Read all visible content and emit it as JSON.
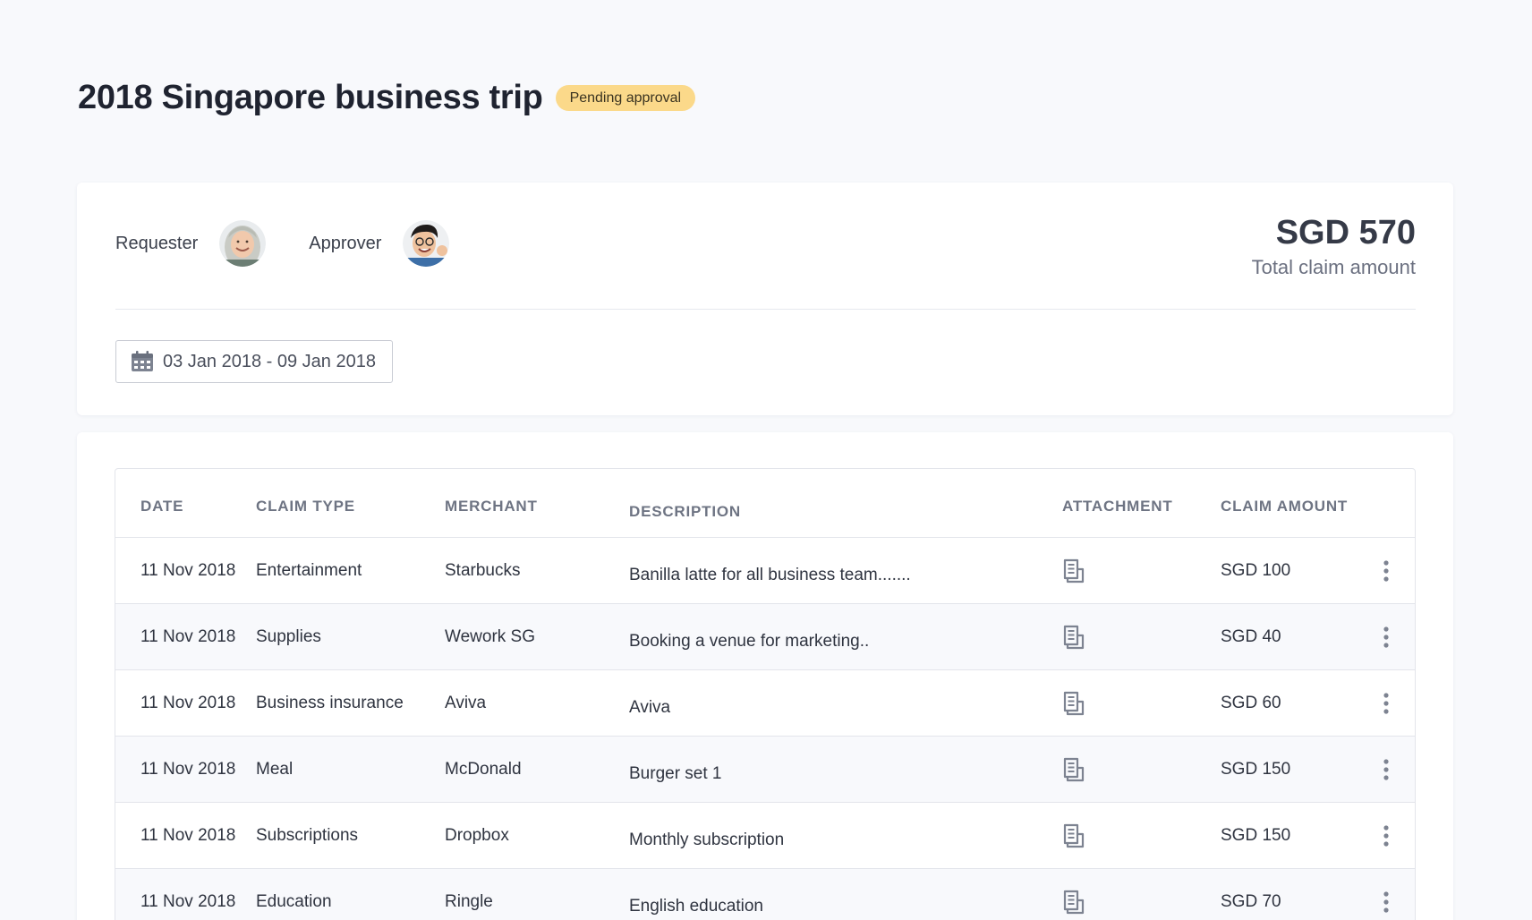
{
  "header": {
    "title": "2018 Singapore business trip",
    "status": "Pending approval"
  },
  "summary": {
    "requester_label": "Requester",
    "approver_label": "Approver",
    "total_amount": "SGD 570",
    "total_label": "Total claim amount",
    "date_range": "03 Jan 2018 - 09 Jan 2018",
    "date_icon": "calendar-icon"
  },
  "table": {
    "columns": {
      "date": "DATE",
      "claim_type": "CLAIM TYPE",
      "merchant": "MERCHANT",
      "description": "DESCRIPTION",
      "attachment": "ATTACHMENT",
      "claim_amount": "CLAIM AMOUNT"
    },
    "rows": [
      {
        "date": "11 Nov 2018",
        "claim_type": "Entertainment",
        "merchant": "Starbucks",
        "description": "Banilla latte for all business team.......",
        "amount": "SGD 100"
      },
      {
        "date": "11 Nov 2018",
        "claim_type": "Supplies",
        "merchant": "Wework SG",
        "description": "Booking a venue for marketing..",
        "amount": "SGD 40"
      },
      {
        "date": "11 Nov 2018",
        "claim_type": "Business insurance",
        "merchant": "Aviva",
        "description": "Aviva",
        "amount": "SGD 60"
      },
      {
        "date": "11 Nov 2018",
        "claim_type": "Meal",
        "merchant": "McDonald",
        "description": "Burger set 1",
        "amount": "SGD 150"
      },
      {
        "date": "11 Nov 2018",
        "claim_type": "Subscriptions",
        "merchant": "Dropbox",
        "description": "Monthly subscription",
        "amount": "SGD 150"
      },
      {
        "date": "11 Nov 2018",
        "claim_type": "Education",
        "merchant": "Ringle",
        "description": "English education",
        "amount": "SGD 70"
      }
    ]
  },
  "colors": {
    "badge": "#fbd98a",
    "background": "#f8f9fc",
    "text": "#2b2f3a"
  }
}
